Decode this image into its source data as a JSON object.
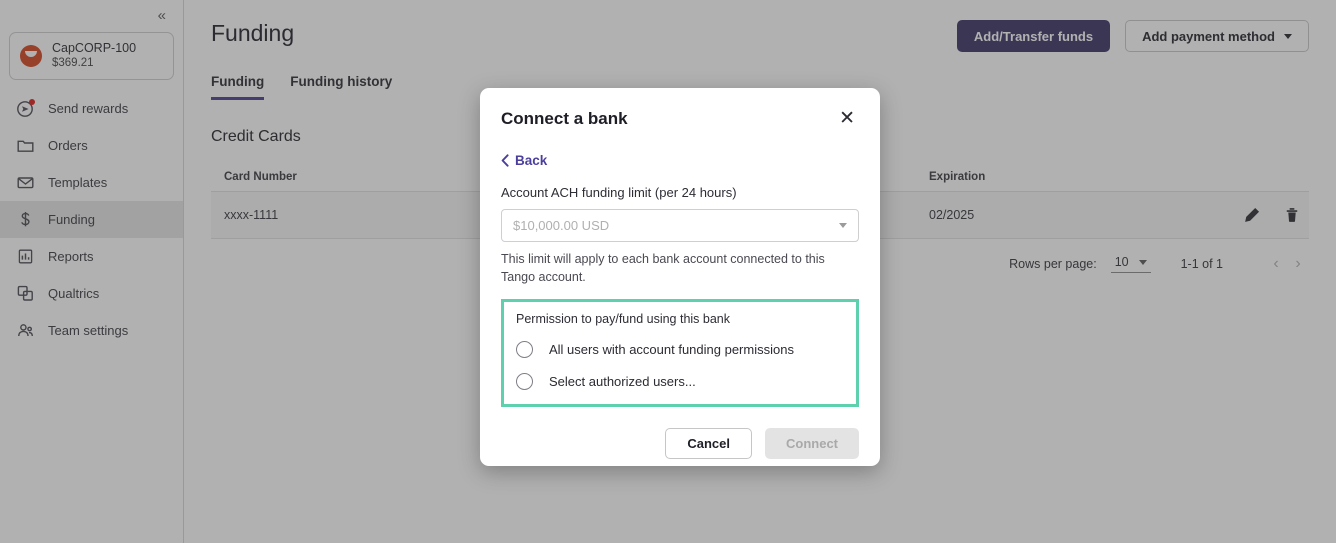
{
  "sidebar": {
    "collapse_icon": "chevrons-left-icon",
    "account": {
      "name": "CapCORP-100",
      "balance": "$369.21",
      "logo": "tango-logo-icon"
    },
    "items": [
      {
        "label": "Send rewards",
        "icon": "send-rewards-icon",
        "active": false,
        "badge": true
      },
      {
        "label": "Orders",
        "icon": "folder-icon",
        "active": false,
        "badge": false
      },
      {
        "label": "Templates",
        "icon": "envelope-icon",
        "active": false,
        "badge": false
      },
      {
        "label": "Funding",
        "icon": "dollar-icon",
        "active": true,
        "badge": false
      },
      {
        "label": "Reports",
        "icon": "bar-chart-icon",
        "active": false,
        "badge": false
      },
      {
        "label": "Qualtrics",
        "icon": "qualtrics-icon",
        "active": false,
        "badge": false
      },
      {
        "label": "Team settings",
        "icon": "people-icon",
        "active": false,
        "badge": false
      }
    ]
  },
  "header": {
    "title": "Funding",
    "primary_button": "Add/Transfer funds",
    "secondary_button": "Add payment method"
  },
  "tabs": [
    {
      "label": "Funding",
      "active": true
    },
    {
      "label": "Funding history",
      "active": false
    }
  ],
  "section": {
    "title": "Credit Cards"
  },
  "table": {
    "columns": [
      "Card Number",
      "",
      "Expiration",
      ""
    ],
    "rows": [
      {
        "card_number": "xxxx-1111",
        "type": "",
        "expiration": "02/2025",
        "edit_icon": "pencil-icon",
        "delete_icon": "trash-icon"
      }
    ]
  },
  "pagination": {
    "rows_per_page_label": "Rows per page:",
    "rows_per_page_value": "10",
    "range": "1-1 of 1",
    "prev_icon": "chevron-left-icon",
    "next_icon": "chevron-right-icon"
  },
  "modal": {
    "title": "Connect a bank",
    "close_icon": "close-icon",
    "back_label": "Back",
    "back_icon": "chevron-left-icon",
    "limit_label": "Account ACH funding limit (per 24 hours)",
    "limit_placeholder": "$10,000.00 USD",
    "limit_caret_icon": "caret-down-icon",
    "help_text": "This limit will apply to each bank account connected to this Tango account.",
    "permission_label": "Permission to pay/fund using this bank",
    "options": [
      {
        "label": "All users with account funding permissions",
        "selected": false
      },
      {
        "label": "Select authorized users...",
        "selected": false
      }
    ],
    "cancel_label": "Cancel",
    "connect_label": "Connect",
    "highlight_color": "#5fd0ae"
  },
  "colors": {
    "brand_purple": "#3d3366",
    "link_purple": "#4b3f9e",
    "logo_orange": "#d4441f",
    "highlight_teal": "#5fd0ae",
    "badge_red": "#e01b1b"
  }
}
